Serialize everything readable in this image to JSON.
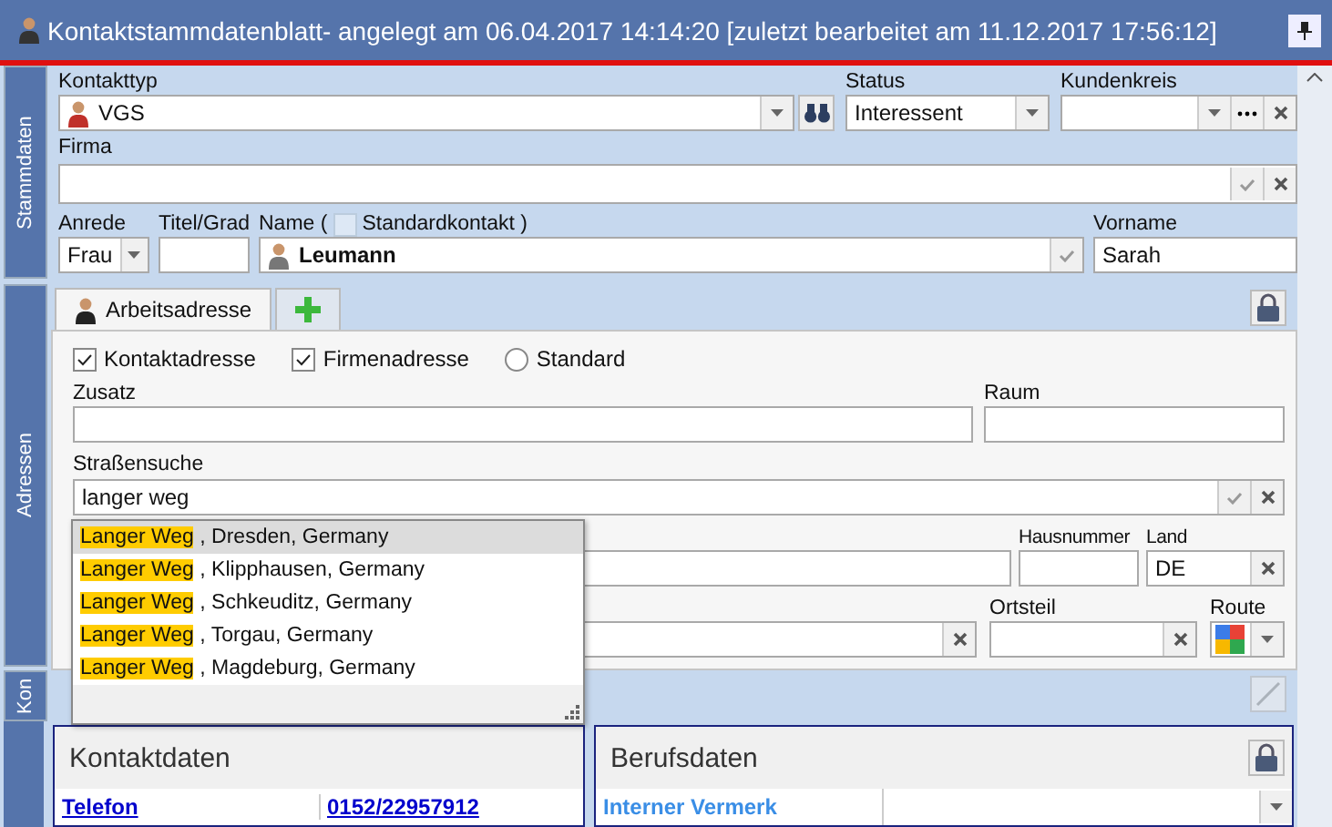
{
  "window": {
    "title": "Kontaktstammdatenblatt- angelegt am 06.04.2017 14:14:20 [zuletzt bearbeitet am 11.12.2017 17:56:12]"
  },
  "sections": [
    {
      "label": "Stammdaten"
    },
    {
      "label": "Adressen"
    },
    {
      "label": "Kon"
    }
  ],
  "stammdaten": {
    "kontakttyp": {
      "label": "Kontakttyp",
      "value": "VGS"
    },
    "status": {
      "label": "Status",
      "value": "Interessent"
    },
    "kundenkreis": {
      "label": "Kundenkreis"
    },
    "firma": {
      "label": "Firma"
    },
    "anrede": {
      "label": "Anrede",
      "value": "Frau"
    },
    "titel": {
      "label": "Titel/Grad"
    },
    "name": {
      "label": "Name (",
      "checkbox_label": "Standardkontakt )",
      "standard_checked": false,
      "value": "Leumann"
    },
    "vorname": {
      "label": "Vorname",
      "value": "Sarah"
    }
  },
  "address_tabs": [
    {
      "label": "Arbeitsadresse",
      "selected": true
    }
  ],
  "address_options": [
    {
      "kind": "checkbox",
      "label": "Kontaktadresse",
      "checked": true
    },
    {
      "kind": "checkbox",
      "label": "Firmenadresse",
      "checked": true
    },
    {
      "kind": "radio",
      "label": "Standard",
      "checked": false
    }
  ],
  "adresse": {
    "zusatz": {
      "label": "Zusatz"
    },
    "raum": {
      "label": "Raum"
    },
    "strassensuche": {
      "label": "Straßensuche",
      "value": "langer weg"
    },
    "hausnummer": {
      "label": "Hausnummer"
    },
    "land": {
      "label": "Land",
      "value": "DE"
    },
    "ortsteil": {
      "label": "Ortsteil"
    },
    "route": {
      "label": "Route"
    }
  },
  "suggestions": [
    {
      "match": "Langer Weg",
      "rest": ", Dresden, Germany",
      "selected": true
    },
    {
      "match": "Langer Weg",
      "rest": ", Klipphausen, Germany",
      "selected": false
    },
    {
      "match": "Langer Weg",
      "rest": ", Schkeuditz, Germany",
      "selected": false
    },
    {
      "match": "Langer Weg",
      "rest": ", Torgau, Germany",
      "selected": false
    },
    {
      "match": "Langer Weg",
      "rest": ", Magdeburg, Germany",
      "selected": false
    }
  ],
  "kontaktdaten": {
    "title": "Kontaktdaten",
    "rows": [
      {
        "label": "Telefon",
        "value": "0152/22957912"
      }
    ]
  },
  "berufsdaten": {
    "title": "Berufsdaten",
    "rows": [
      {
        "label": "Interner Vermerk"
      }
    ]
  }
}
